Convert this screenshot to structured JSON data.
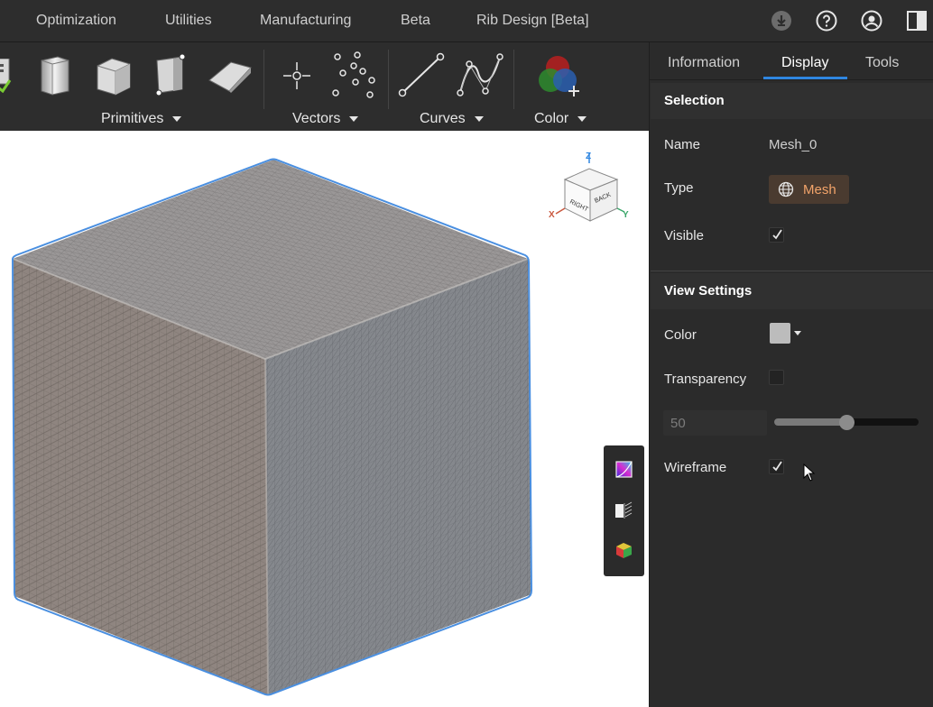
{
  "menu": {
    "items": [
      "Optimization",
      "Utilities",
      "Manufacturing",
      "Beta",
      "Rib Design [Beta]"
    ],
    "icons": [
      "download-icon",
      "help-icon",
      "account-icon",
      "panel-toggle-icon"
    ]
  },
  "toolbar": {
    "groups": [
      {
        "label": "Primitives",
        "icons": [
          "cylinder-primitive-icon",
          "box-primitive-icon",
          "box-corners-primitive-icon",
          "wedge-primitive-icon"
        ]
      },
      {
        "label": "Vectors",
        "icons": [
          "point-icon",
          "point-cloud-icon"
        ]
      },
      {
        "label": "Curves",
        "icons": [
          "line-icon",
          "spline-icon"
        ]
      },
      {
        "label": "Color",
        "icons": [
          "color-mix-icon"
        ]
      }
    ]
  },
  "viewport": {
    "viewcube": {
      "axis_z": "Z",
      "axis_x": "X",
      "axis_y": "Y",
      "face_right": "RIGHT",
      "face_back": "BACK"
    },
    "tools": [
      "color-map-icon",
      "section-view-icon",
      "appearance-icon"
    ],
    "mesh_edge_color": "#4a8fe0"
  },
  "panel": {
    "tabs": [
      "Information",
      "Display",
      "Tools"
    ],
    "active_tab": "Display",
    "selection": {
      "header": "Selection",
      "name_label": "Name",
      "name_value": "Mesh_0",
      "type_label": "Type",
      "type_value": "Mesh",
      "visible_label": "Visible",
      "visible_checked": true
    },
    "view_settings": {
      "header": "View Settings",
      "color_label": "Color",
      "color_value": "#bcbcbc",
      "transparency_label": "Transparency",
      "transparency_checked": false,
      "transparency_value": "50",
      "transparency_fraction": 0.5,
      "wireframe_label": "Wireframe",
      "wireframe_checked": true
    }
  },
  "colors": {
    "accent": "#2f86e0",
    "mesh_badge_text": "#f3a46a",
    "mesh_badge_bg": "#4a3b30"
  }
}
